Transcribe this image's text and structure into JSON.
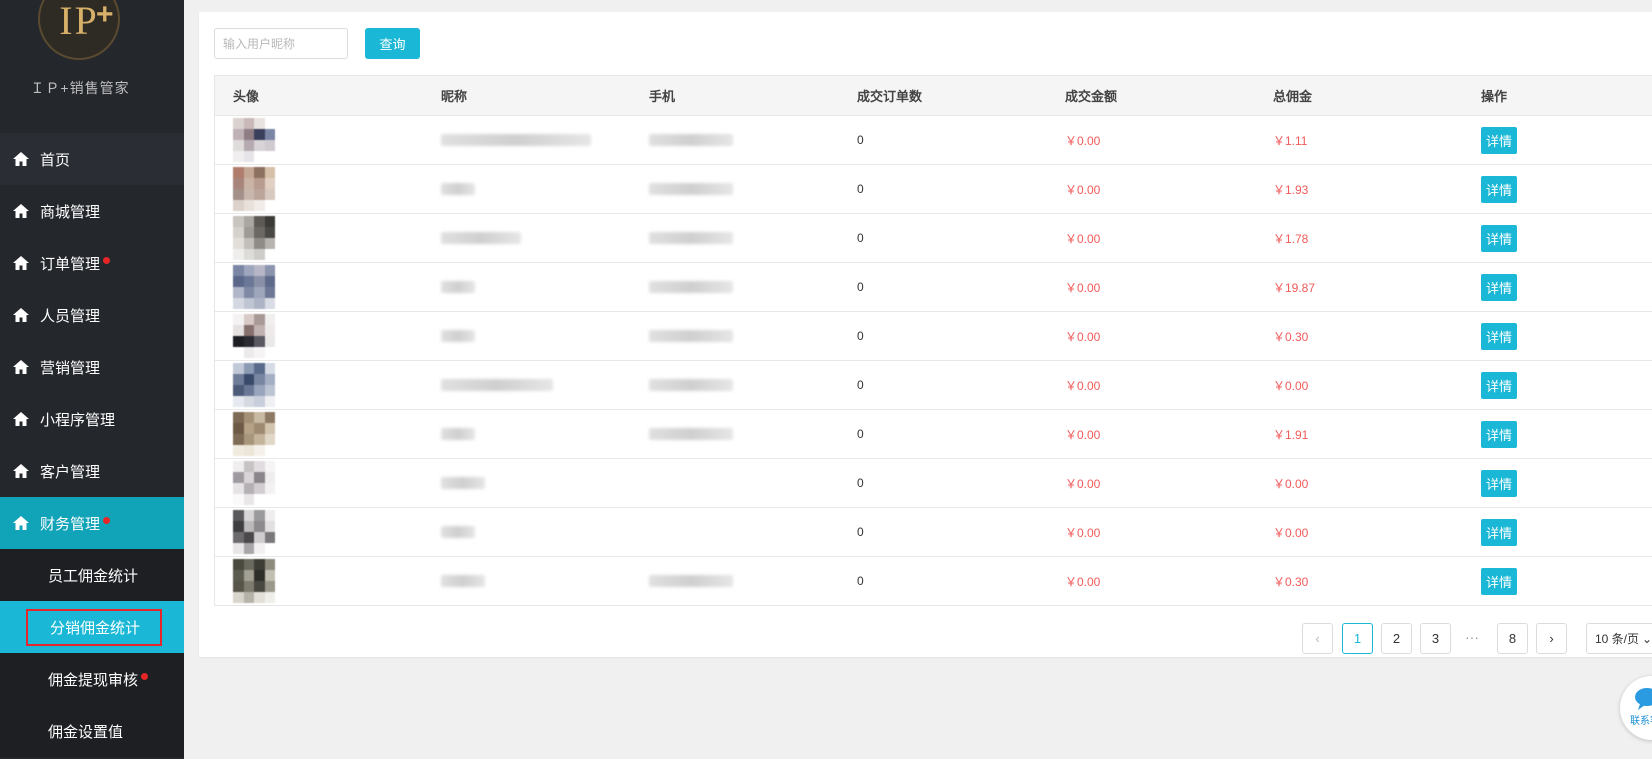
{
  "sidebar": {
    "brand": "ＩＰ+销售管家",
    "logo_text": "IP",
    "logo_plus": "+",
    "items": [
      {
        "label": "首页",
        "dot": false
      },
      {
        "label": "商城管理",
        "dot": false
      },
      {
        "label": "订单管理",
        "dot": true
      },
      {
        "label": "人员管理",
        "dot": false
      },
      {
        "label": "营销管理",
        "dot": false
      },
      {
        "label": "小程序管理",
        "dot": false
      },
      {
        "label": "客户管理",
        "dot": false
      },
      {
        "label": "财务管理",
        "dot": true
      }
    ],
    "sub_items": [
      {
        "label": "员工佣金统计",
        "dot": false
      },
      {
        "label": "分销佣金统计",
        "dot": false
      },
      {
        "label": "佣金提现审核",
        "dot": true
      },
      {
        "label": "佣金设置值",
        "dot": false
      }
    ]
  },
  "search": {
    "placeholder": "输入用户昵称",
    "value": "",
    "button": "查询"
  },
  "table": {
    "headers": [
      "头像",
      "昵称",
      "手机",
      "成交订单数",
      "成交金额",
      "总佣金",
      "操作"
    ],
    "rows": [
      {
        "orders": "0",
        "amount": "￥0.00",
        "commission": "￥1.11",
        "action": "详情"
      },
      {
        "orders": "0",
        "amount": "￥0.00",
        "commission": "￥1.93",
        "action": "详情"
      },
      {
        "orders": "0",
        "amount": "￥0.00",
        "commission": "￥1.78",
        "action": "详情"
      },
      {
        "orders": "0",
        "amount": "￥0.00",
        "commission": "￥19.87",
        "action": "详情"
      },
      {
        "orders": "0",
        "amount": "￥0.00",
        "commission": "￥0.30",
        "action": "详情"
      },
      {
        "orders": "0",
        "amount": "￥0.00",
        "commission": "￥0.00",
        "action": "详情"
      },
      {
        "orders": "0",
        "amount": "￥0.00",
        "commission": "￥1.91",
        "action": "详情"
      },
      {
        "orders": "0",
        "amount": "￥0.00",
        "commission": "￥0.00",
        "action": "详情"
      },
      {
        "orders": "0",
        "amount": "￥0.00",
        "commission": "￥0.00",
        "action": "详情"
      },
      {
        "orders": "0",
        "amount": "￥0.00",
        "commission": "￥0.30",
        "action": "详情"
      }
    ]
  },
  "pagination": {
    "prev": "‹",
    "next": "›",
    "pages": [
      "1",
      "2",
      "3"
    ],
    "ellipsis": "···",
    "last": "8",
    "current": "1",
    "page_size": "10 条/页"
  },
  "chat": {
    "label": "联系客服"
  },
  "colors": {
    "accent": "#1ab8d6",
    "money": "#f25a5a",
    "sidebar": "#24272c",
    "active_nav": "#11a3b8",
    "dot": "#e62626"
  },
  "icons": {
    "nav": "home-icon",
    "page_size_arrow": "chevron-down-icon",
    "chat": "chat-bubble-icon"
  }
}
